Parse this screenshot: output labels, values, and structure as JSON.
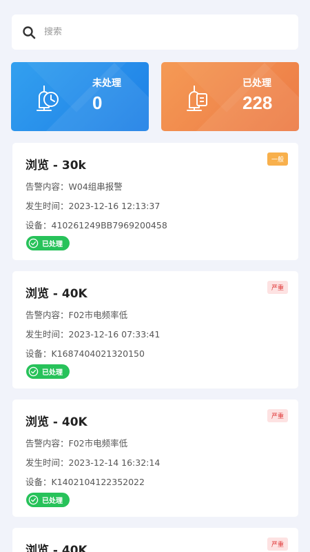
{
  "search": {
    "placeholder": "搜索"
  },
  "stats": [
    {
      "label": "未处理",
      "value": "0"
    },
    {
      "label": "已处理",
      "value": "228"
    }
  ],
  "labels": {
    "content": "告警内容：",
    "time": "发生时间：",
    "device": "设备："
  },
  "alarms": [
    {
      "title": "浏览 - 30k",
      "level": "一般",
      "content": "W04组串报警",
      "time": "2023-12-16 12:13:37",
      "device": "410261249BB7969200458",
      "status": "已处理"
    },
    {
      "title": "浏览 - 40K",
      "level": "严重",
      "content": "F02市电频率低",
      "time": "2023-12-16 07:33:41",
      "device": "K1687404021320150",
      "status": "已处理"
    },
    {
      "title": "浏览 - 40K",
      "level": "严重",
      "content": "F02市电频率低",
      "time": "2023-12-14 16:32:14",
      "device": "K1402104122352022",
      "status": "已处理"
    },
    {
      "title": "浏览 - 40K",
      "level": "严重"
    }
  ],
  "colors": {
    "accent_blue": "#1d7fe6",
    "accent_orange": "#ec7a45",
    "success": "#27c25a",
    "severe": "#e03a3a",
    "normal": "#f8b04c"
  }
}
